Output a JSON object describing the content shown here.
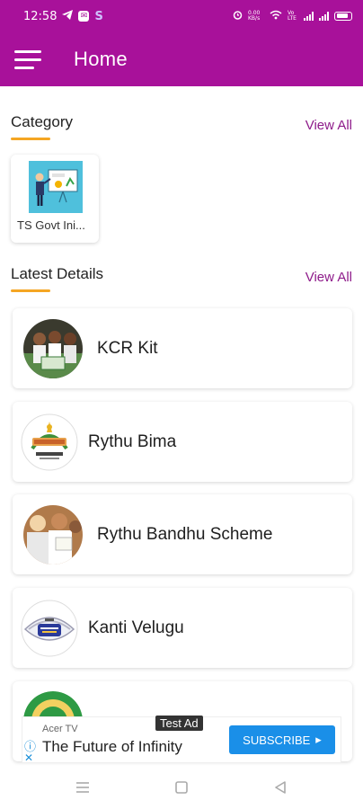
{
  "status_bar": {
    "time": "12:58",
    "left_icons": [
      "telegram-icon",
      "app-notification-icon",
      "skype-icon"
    ],
    "right_icons": [
      "alarm-icon",
      "data-speed-icon",
      "wifi-icon",
      "volte-icon",
      "signal-icon",
      "signal-icon",
      "battery-icon"
    ],
    "data_speed": "0.00 KB/s",
    "network_tag": "Vo LTE"
  },
  "app_bar": {
    "title": "Home",
    "menu_icon": "hamburger-menu-icon",
    "background": "#a8119a"
  },
  "category_section": {
    "title": "Category",
    "view_all": "View All",
    "items": [
      {
        "label": "TS Govt Ini...",
        "thumbnail": "presentation-board-icon"
      }
    ]
  },
  "latest_section": {
    "title": "Latest Details",
    "view_all": "View All",
    "items": [
      {
        "label": "KCR Kit",
        "image": "kcr-kit-photo"
      },
      {
        "label": "Rythu Bima",
        "image": "rythu-bima-logo"
      },
      {
        "label": "Rythu Bandhu Scheme",
        "image": "rythu-bandhu-photo"
      },
      {
        "label": "Kanti Velugu",
        "image": "kanti-velugu-logo"
      },
      {
        "label": "",
        "image": "partial-emblem-logo"
      }
    ]
  },
  "ad": {
    "tag": "Test Ad",
    "advertiser": "Acer TV",
    "headline": "The Future of Infinity",
    "cta": "SUBSCRIBE",
    "info_icon": "info-icon",
    "close_icon": "close-icon"
  },
  "nav_bar": {
    "buttons": [
      "recent-apps-icon",
      "home-icon",
      "back-icon"
    ]
  },
  "colors": {
    "primary": "#a8119a",
    "accent": "#f5a623",
    "view_all": "#8e1b8a",
    "ad_button": "#1a8fe8"
  }
}
